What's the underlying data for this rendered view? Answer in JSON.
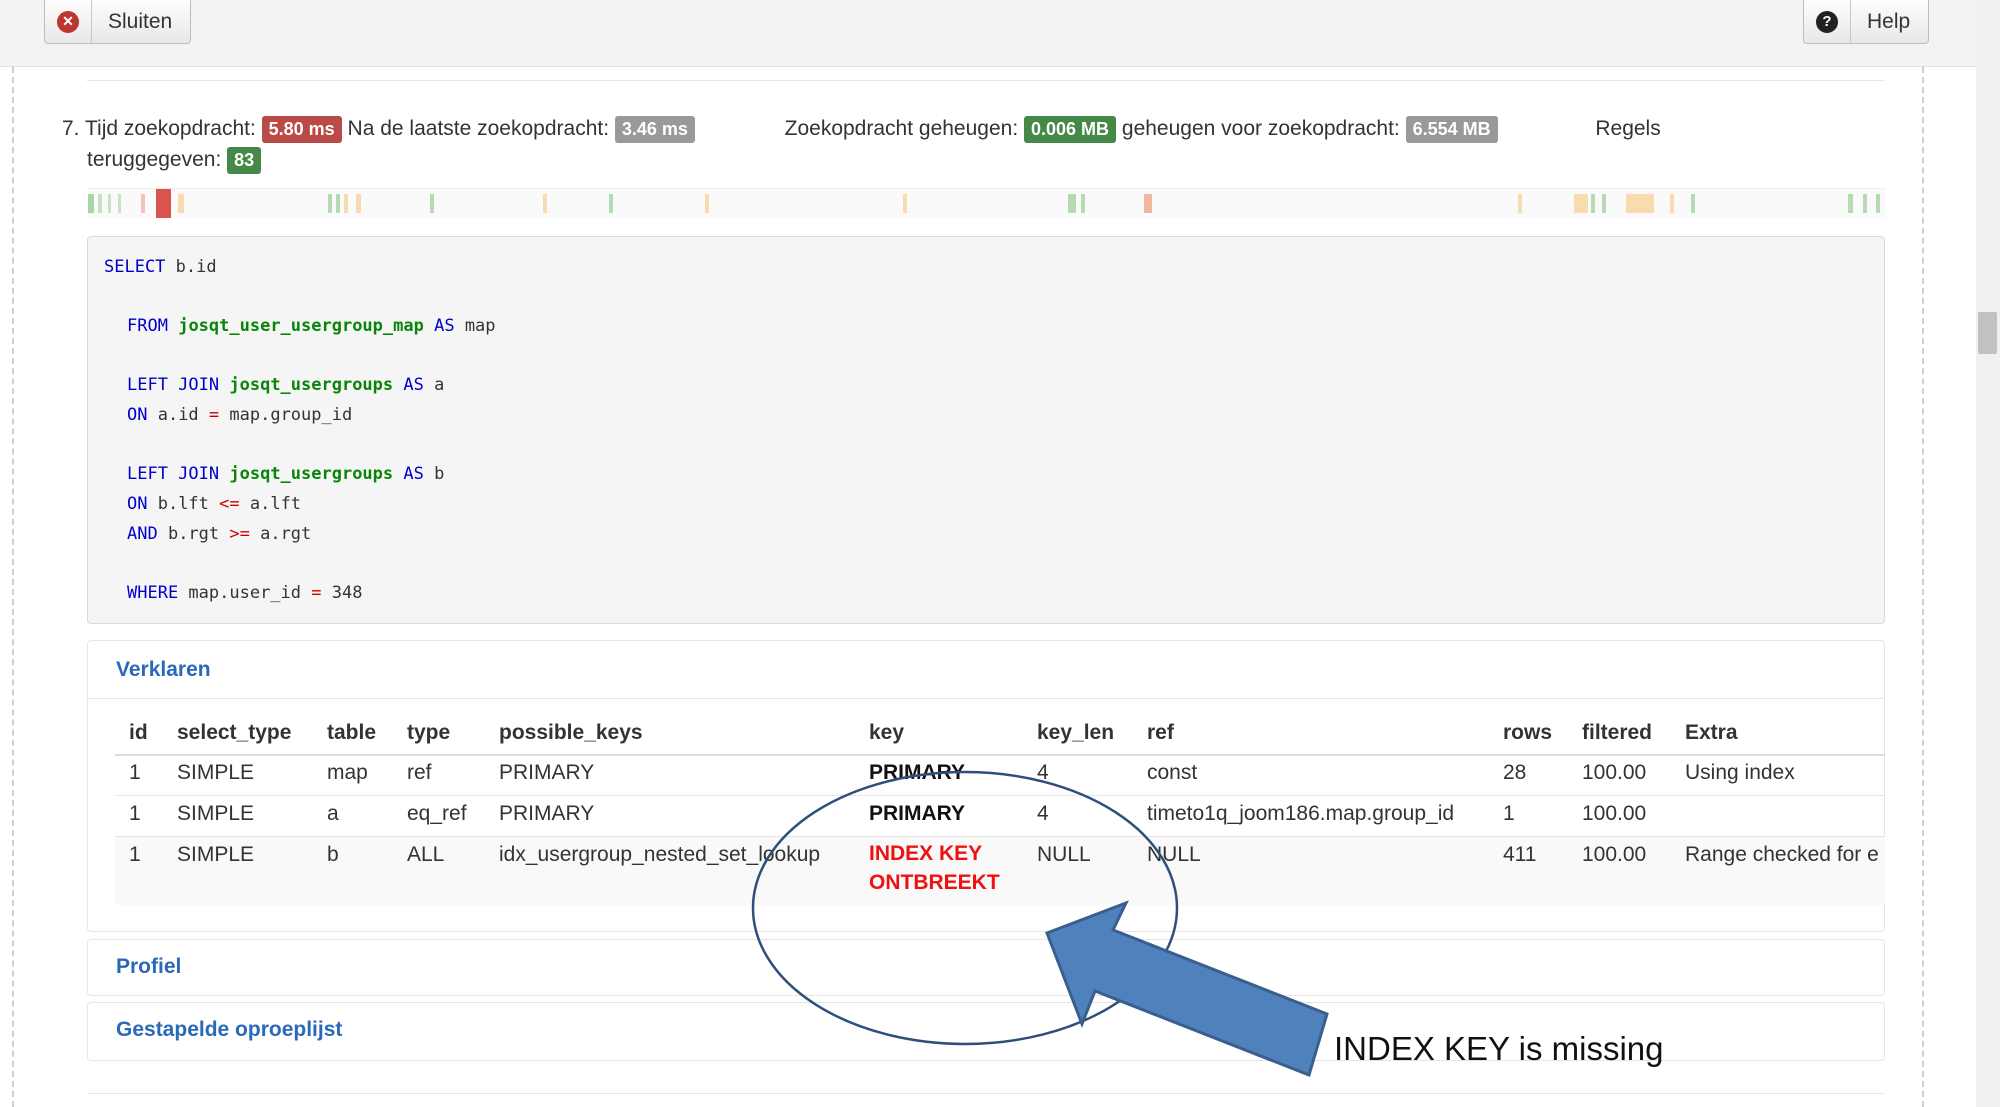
{
  "toolbar": {
    "close_label": "Sluiten",
    "help_label": "Help"
  },
  "query": {
    "number": "7.",
    "time_label": "Tijd zoekopdracht:",
    "time_value": "5.80 ms",
    "after_label": "Na de laatste zoekopdracht:",
    "after_value": "3.46 ms",
    "memory_label": "Zoekopdracht geheugen:",
    "memory_value": "0.006 MB",
    "memory_before_label": "geheugen voor zoekopdracht:",
    "memory_before_value": "6.554 MB",
    "rows_label_1": "Regels",
    "rows_label_2": "teruggegeven:",
    "rows_value": "83"
  },
  "sql": {
    "l1_kw": "SELECT",
    "l1_rest": " b.id",
    "l2_kw": "FROM",
    "l2_table": "josqt_user_usergroup_map",
    "l2_as": "AS",
    "l2_alias": " map",
    "l3_kw": "LEFT JOIN",
    "l3_table": "josqt_usergroups",
    "l3_as": "AS",
    "l3_alias": " a",
    "l4_kw": "ON",
    "l4_left": " a.id ",
    "l4_op": "=",
    "l4_right": " map.group_id",
    "l5_kw": "LEFT JOIN",
    "l5_table": "josqt_usergroups",
    "l5_as": "AS",
    "l5_alias": " b",
    "l6_kw": "ON",
    "l6_left": " b.lft ",
    "l6_op": "<=",
    "l6_right": " a.lft",
    "l7_kw": "AND",
    "l7_left": " b.rgt ",
    "l7_op": ">=",
    "l7_right": " a.rgt",
    "l8_kw": "WHERE",
    "l8_left": " map.user_id ",
    "l8_op": "=",
    "l8_right": " 348"
  },
  "explain": {
    "title": "Verklaren",
    "columns": [
      "id",
      "select_type",
      "table",
      "type",
      "possible_keys",
      "key",
      "key_len",
      "ref",
      "rows",
      "filtered",
      "Extra"
    ],
    "rows": [
      [
        "1",
        "SIMPLE",
        "map",
        "ref",
        "PRIMARY",
        "PRIMARY",
        "4",
        "const",
        "28",
        "100.00",
        "Using index"
      ],
      [
        "1",
        "SIMPLE",
        "a",
        "eq_ref",
        "PRIMARY",
        "PRIMARY",
        "4",
        "timeto1q_joom186.map.group_id",
        "1",
        "100.00",
        ""
      ],
      [
        "1",
        "SIMPLE",
        "b",
        "ALL",
        "idx_usergroup_nested_set_lookup",
        "INDEX KEY ONTBREEKT",
        "NULL",
        "NULL",
        "411",
        "100.00",
        "Range checked for e"
      ]
    ]
  },
  "profile": {
    "title": "Profiel"
  },
  "callstack": {
    "title": "Gestapelde oproeplijst"
  },
  "annotation": {
    "text": "INDEX KEY is missing"
  },
  "colors": {
    "danger": "#b94a48",
    "muted": "#999999",
    "success": "#468847",
    "link": "#2a69b8",
    "missing_key": "#ee1111",
    "annotation": "#4f81bd"
  },
  "icons": {
    "close": "x-circle-icon",
    "help": "question-circle-icon"
  }
}
